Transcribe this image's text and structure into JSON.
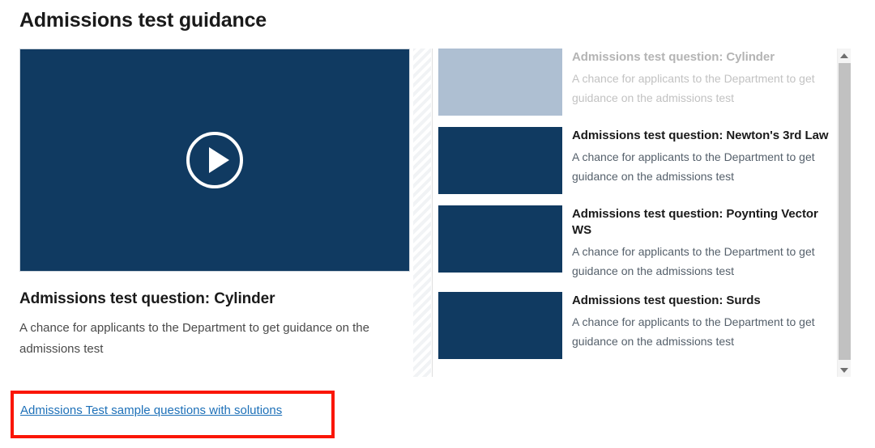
{
  "page": {
    "title": "Admissions test guidance"
  },
  "featured": {
    "title": "Admissions test question: Cylinder",
    "description": "A chance for applicants to the Department to get guidance on the admissions test",
    "play_icon": "play-circle-icon"
  },
  "playlist": {
    "items": [
      {
        "title": "Admissions test question: Cylinder",
        "description": "A chance for applicants to the Department to get guidance on the admissions test",
        "active": true,
        "thumbnail_color": "#aebfd2"
      },
      {
        "title": "Admissions test question: Newton's 3rd Law",
        "description": "A chance for applicants to the Department to get guidance on the admissions test",
        "active": false,
        "thumbnail_color": "#103a61"
      },
      {
        "title": "Admissions test question: Poynting Vector WS",
        "description": "A chance for applicants to the Department to get guidance on the admissions test",
        "active": false,
        "thumbnail_color": "#103a61"
      },
      {
        "title": "Admissions test question: Surds",
        "description": "A chance for applicants to the Department to get guidance on the admissions test",
        "active": false,
        "thumbnail_color": "#103a61"
      }
    ]
  },
  "scrollbar": {
    "up_icon": "chevron-up-icon",
    "down_icon": "chevron-down-icon"
  },
  "bottom_link": {
    "label": "Admissions Test sample questions with solutions"
  },
  "colors": {
    "video_navy": "#103a61",
    "active_thumb": "#aebfd2",
    "link_blue": "#1d70b8",
    "annotation_red": "#fa1605",
    "scrollbar_thumb": "#c1c1c1"
  }
}
